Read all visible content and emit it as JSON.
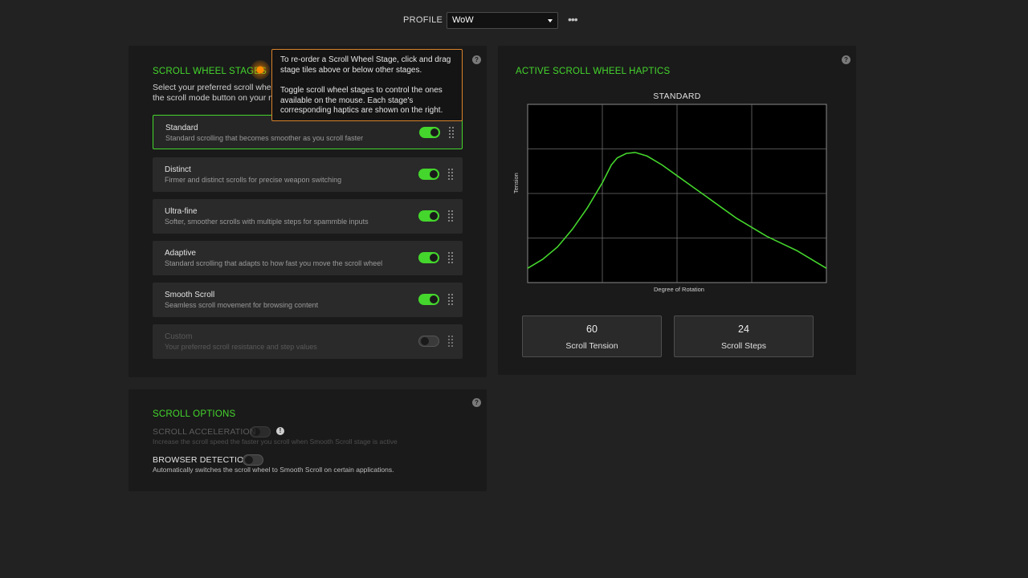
{
  "profile": {
    "label": "PROFILE",
    "selected": "WoW",
    "more_icon": "ellipsis-icon"
  },
  "stages": {
    "title": "SCROLL WHEEL STAGES",
    "desc_line1": "Select your preferred scroll whee",
    "desc_line2": "the scroll mode button on your m",
    "items": [
      {
        "name": "Standard",
        "desc": "Standard scrolling that becomes smoother as you scroll faster",
        "enabled": true,
        "selected": true
      },
      {
        "name": "Distinct",
        "desc": "Firmer and distinct scrolls for precise weapon switching",
        "enabled": true,
        "selected": false
      },
      {
        "name": "Ultra-fine",
        "desc": "Softer, smoother scrolls with multiple steps for spammble inputs",
        "enabled": true,
        "selected": false
      },
      {
        "name": "Adaptive",
        "desc": "Standard scrolling that adapts to how fast you move the scroll wheel",
        "enabled": true,
        "selected": false
      },
      {
        "name": "Smooth Scroll",
        "desc": "Seamless scroll movement for browsing content",
        "enabled": true,
        "selected": false
      },
      {
        "name": "Custom",
        "desc": "Your preferred scroll resistance and step values",
        "enabled": false,
        "selected": false
      }
    ]
  },
  "tooltip": {
    "p1": "To re-order a Scroll Wheel Stage, click and drag stage tiles above or below other stages.",
    "p2": "Toggle scroll wheel stages to control the ones available on the mouse. Each stage's corresponding haptics are shown on the right."
  },
  "haptics": {
    "title": "ACTIVE SCROLL WHEEL HAPTICS",
    "tension_value": "60",
    "tension_label": "Scroll Tension",
    "steps_value": "24",
    "steps_label": "Scroll Steps"
  },
  "chart_data": {
    "type": "line",
    "title": "STANDARD",
    "xlabel": "Degree of Rotation",
    "ylabel": "Tension",
    "grid": true,
    "xlim": [
      0,
      100
    ],
    "ylim": [
      0,
      100
    ],
    "series": [
      {
        "color": "#44d62c",
        "x": [
          0,
          5,
          10,
          15,
          20,
          25,
          28,
          30,
          33,
          36,
          40,
          45,
          50,
          55,
          60,
          65,
          70,
          75,
          80,
          85,
          90,
          95,
          100
        ],
        "y": [
          8,
          13,
          20,
          30,
          42,
          56,
          66,
          70,
          72.5,
          73,
          71,
          66,
          60,
          54,
          48,
          42,
          36,
          31,
          26,
          22,
          18,
          13,
          8
        ]
      }
    ]
  },
  "options": {
    "title": "SCROLL OPTIONS",
    "accel_label": "SCROLL ACCELERATION",
    "accel_desc": "Increase the scroll speed the faster you scroll when Smooth Scroll stage is active",
    "accel_enabled": false,
    "browser_label": "BROWSER DETECTION",
    "browser_desc": "Automatically switches the scroll wheel to Smooth Scroll on certain applications.",
    "browser_enabled": false
  },
  "colors": {
    "accent": "#44d62c",
    "tooltip_border": "#d9822b",
    "background": "#222222",
    "panel": "#1a1a1a"
  },
  "icons": {
    "help": "?",
    "info": "!"
  }
}
